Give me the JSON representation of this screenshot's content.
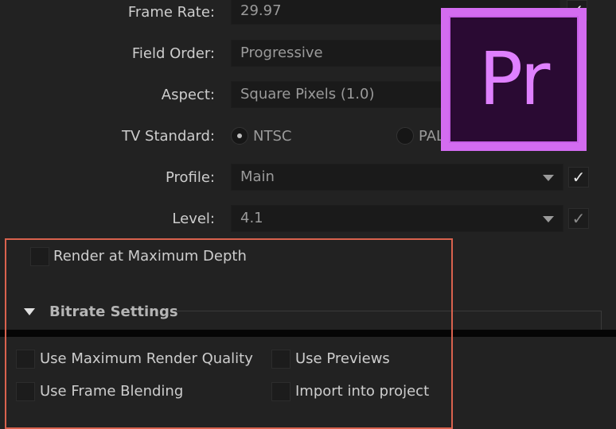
{
  "settings": {
    "frame_rate": {
      "label": "Frame Rate:",
      "value": "29.97"
    },
    "field_order": {
      "label": "Field Order:",
      "value": "Progressive"
    },
    "aspect": {
      "label": "Aspect:",
      "value": "Square Pixels (1.0)"
    },
    "tv_standard": {
      "label": "TV Standard:",
      "options": [
        "NTSC",
        "PAL"
      ],
      "selected": "NTSC"
    },
    "profile": {
      "label": "Profile:",
      "value": "Main"
    },
    "level": {
      "label": "Level:",
      "value": "4.1"
    }
  },
  "checkmark": "✓",
  "render_max_depth": {
    "label": "Render at Maximum Depth",
    "checked": false
  },
  "bitrate_section": {
    "title": "Bitrate Settings",
    "expanded": true
  },
  "bottom_options": [
    {
      "label": "Use Maximum Render Quality",
      "checked": false
    },
    {
      "label": "Use Previews",
      "checked": false
    },
    {
      "label": "Use Frame Blending",
      "checked": false
    },
    {
      "label": "Import into project",
      "checked": false
    }
  ],
  "logo": {
    "text": "Pr",
    "app": "Adobe Premiere Pro"
  },
  "colors": {
    "background": "#222222",
    "highlight_border": "#d9624e",
    "logo_frame": "#d36cf0",
    "logo_fill": "#2a0a33",
    "logo_text": "#df80ff"
  }
}
